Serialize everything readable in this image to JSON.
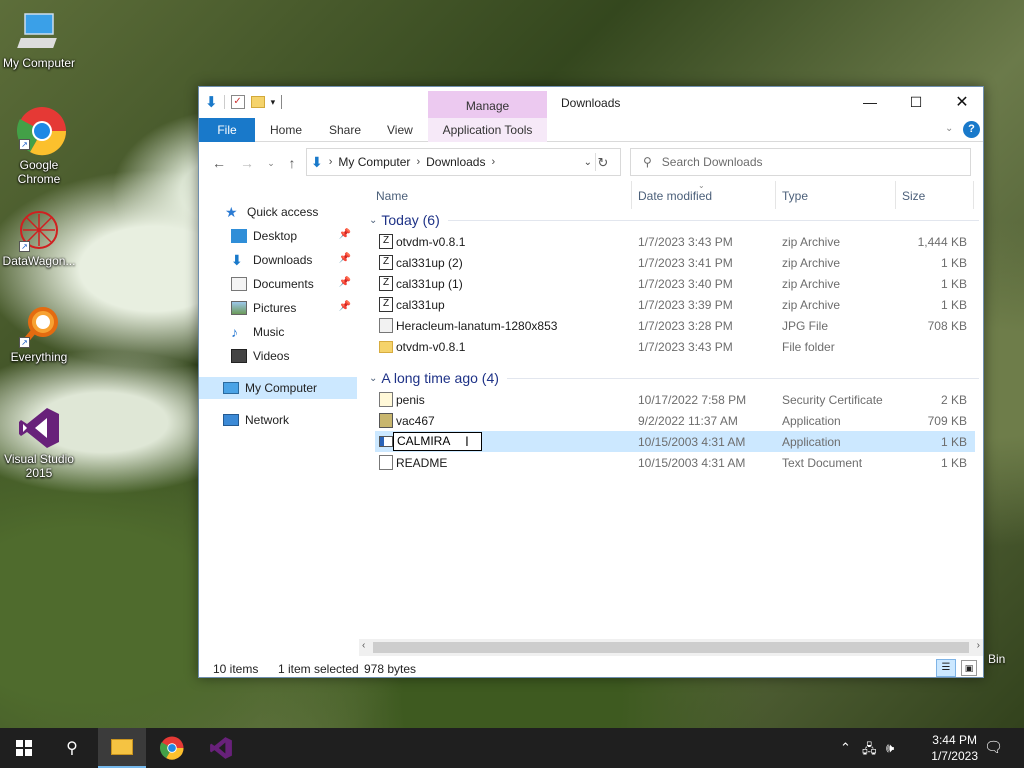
{
  "desktop": {
    "icons": [
      {
        "label": "My Computer"
      },
      {
        "label": "Google Chrome"
      },
      {
        "label": "DataWagon..."
      },
      {
        "label": "Everything"
      },
      {
        "label": "Visual Studio 2015"
      }
    ],
    "recycle_bin_partial": "Bin"
  },
  "window": {
    "title": "Downloads",
    "manage_tab": "Manage",
    "ribbon_tabs": [
      "File",
      "Home",
      "Share",
      "View",
      "Application Tools"
    ],
    "address": [
      "My Computer",
      "Downloads"
    ],
    "search_placeholder": "Search Downloads",
    "nav": [
      {
        "label": "Quick access"
      },
      {
        "label": "Desktop"
      },
      {
        "label": "Downloads"
      },
      {
        "label": "Documents"
      },
      {
        "label": "Pictures"
      },
      {
        "label": "Music"
      },
      {
        "label": "Videos"
      },
      {
        "label": "My Computer"
      },
      {
        "label": "Network"
      }
    ],
    "columns": [
      "Name",
      "Date modified",
      "Type",
      "Size"
    ],
    "groups": [
      {
        "title": "Today (6)",
        "files": [
          {
            "name": "otvdm-v0.8.1",
            "date": "1/7/2023 3:43 PM",
            "type": "zip Archive",
            "size": "1,444 KB"
          },
          {
            "name": "cal331up (2)",
            "date": "1/7/2023 3:41 PM",
            "type": "zip Archive",
            "size": "1 KB"
          },
          {
            "name": "cal331up (1)",
            "date": "1/7/2023 3:40 PM",
            "type": "zip Archive",
            "size": "1 KB"
          },
          {
            "name": "cal331up",
            "date": "1/7/2023 3:39 PM",
            "type": "zip Archive",
            "size": "1 KB"
          },
          {
            "name": "Heracleum-lanatum-1280x853",
            "date": "1/7/2023 3:28 PM",
            "type": "JPG File",
            "size": "708 KB"
          },
          {
            "name": "otvdm-v0.8.1",
            "date": "1/7/2023 3:43 PM",
            "type": "File folder",
            "size": ""
          }
        ]
      },
      {
        "title": "A long time ago (4)",
        "files": [
          {
            "name": "penis",
            "date": "10/17/2022 7:58 PM",
            "type": "Security Certificate",
            "size": "2 KB"
          },
          {
            "name": "vac467",
            "date": "9/2/2022 11:37 AM",
            "type": "Application",
            "size": "709 KB"
          },
          {
            "name": "CALMIRA",
            "date": "10/15/2003 4:31 AM",
            "type": "Application",
            "size": "1 KB"
          },
          {
            "name": "README",
            "date": "10/15/2003 4:31 AM",
            "type": "Text Document",
            "size": "1 KB"
          }
        ]
      }
    ],
    "status": {
      "count": "10 items",
      "selected": "1 item selected",
      "bytes": "978 bytes"
    }
  },
  "taskbar": {
    "time": "3:44 PM",
    "date": "1/7/2023"
  },
  "colors": {
    "accent": "#1979ca",
    "selection": "#cce8ff",
    "manage": "#ecc9f0"
  }
}
